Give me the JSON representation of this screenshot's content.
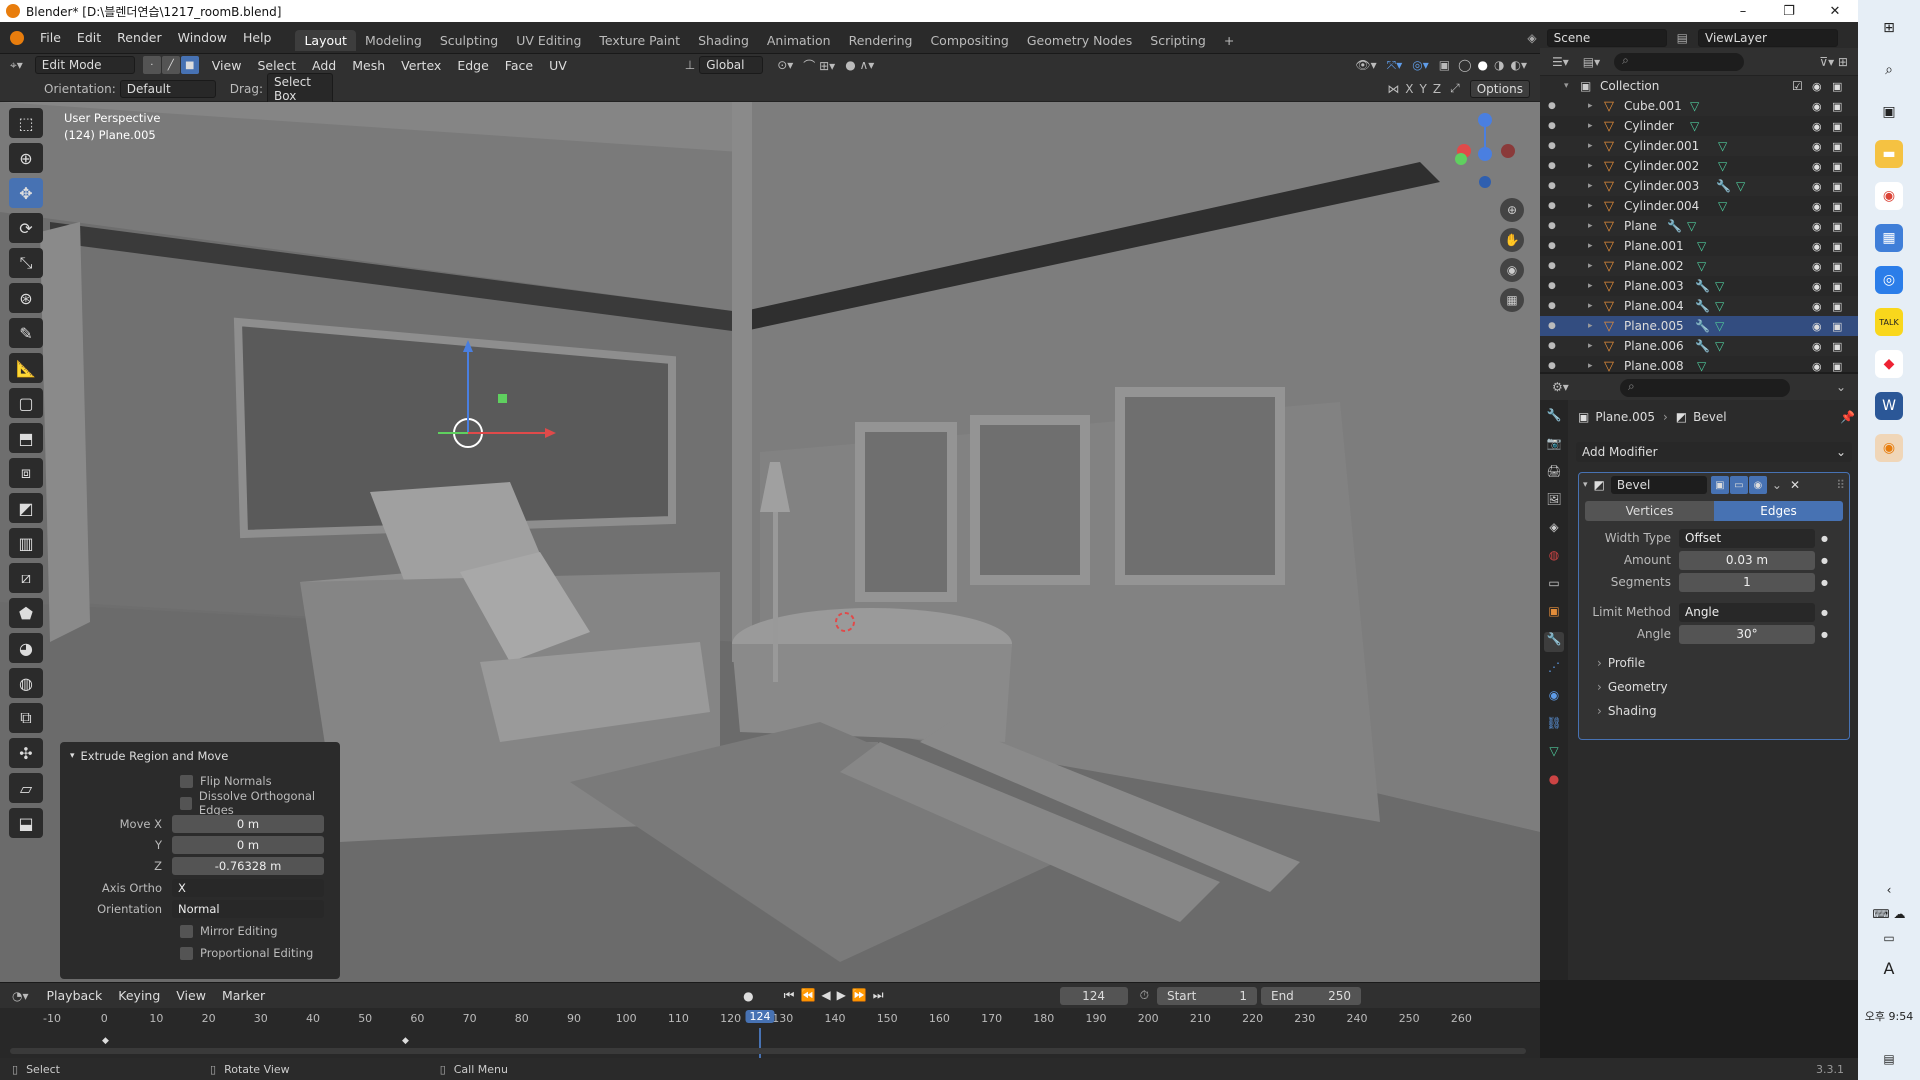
{
  "window": {
    "title": "Blender* [D:\\블렌더연습\\1217_roomB.blend]",
    "min": "–",
    "max": "❐",
    "close": "✕"
  },
  "topmenu": [
    "File",
    "Edit",
    "Render",
    "Window",
    "Help"
  ],
  "workspaces": [
    "Layout",
    "Modeling",
    "Sculpting",
    "UV Editing",
    "Texture Paint",
    "Shading",
    "Animation",
    "Rendering",
    "Compositing",
    "Geometry Nodes",
    "Scripting",
    "+"
  ],
  "scene": "Scene",
  "view_layer": "ViewLayer",
  "viewport_header": {
    "mode": "Edit Mode",
    "menus": [
      "View",
      "Select",
      "Add",
      "Mesh",
      "Vertex",
      "Edge",
      "Face",
      "UV"
    ],
    "transform": "Global"
  },
  "tool_settings": {
    "orientation_label": "Orientation:",
    "orientation": "Default",
    "drag_label": "Drag:",
    "drag": "Select Box",
    "axes": [
      "X",
      "Y",
      "Z"
    ],
    "options": "Options"
  },
  "viewport": {
    "perspective": "User Perspective",
    "object": "(124) Plane.005"
  },
  "operator_panel": {
    "title": "Extrude Region and Move",
    "flip_normals": "Flip Normals",
    "dissolve": "Dissolve Orthogonal Edges",
    "move_x_label": "Move X",
    "move_x": "0 m",
    "y_label": "Y",
    "y": "0 m",
    "z_label": "Z",
    "z": "-0.76328 m",
    "axis_ortho_label": "Axis Ortho",
    "axis_ortho": "X",
    "orientation_label": "Orientation",
    "orientation": "Normal",
    "mirror": "Mirror Editing",
    "proportional": "Proportional Editing"
  },
  "outliner": {
    "collection": "Collection",
    "items": [
      {
        "name": "Cube.001",
        "mod": false
      },
      {
        "name": "Cylinder",
        "mod": false
      },
      {
        "name": "Cylinder.001",
        "mod": false
      },
      {
        "name": "Cylinder.002",
        "mod": false
      },
      {
        "name": "Cylinder.003",
        "mod": true
      },
      {
        "name": "Cylinder.004",
        "mod": false
      },
      {
        "name": "Plane",
        "mod": true
      },
      {
        "name": "Plane.001",
        "mod": false
      },
      {
        "name": "Plane.002",
        "mod": false
      },
      {
        "name": "Plane.003",
        "mod": true
      },
      {
        "name": "Plane.004",
        "mod": true
      },
      {
        "name": "Plane.005",
        "mod": true,
        "selected": true
      },
      {
        "name": "Plane.006",
        "mod": true
      },
      {
        "name": "Plane.008",
        "mod": false
      }
    ]
  },
  "properties": {
    "breadcrumb_obj": "Plane.005",
    "breadcrumb_mod": "Bevel",
    "add_modifier": "Add Modifier",
    "modifier_name": "Bevel",
    "tab_vertices": "Vertices",
    "tab_edges": "Edges",
    "width_type_label": "Width Type",
    "width_type": "Offset",
    "amount_label": "Amount",
    "amount": "0.03 m",
    "segments_label": "Segments",
    "segments": "1",
    "limit_label": "Limit Method",
    "limit": "Angle",
    "angle_label": "Angle",
    "angle": "30°",
    "profile": "Profile",
    "geometry": "Geometry",
    "shading": "Shading"
  },
  "timeline": {
    "menus": [
      "Playback",
      "Keying",
      "View",
      "Marker"
    ],
    "current": "124",
    "start_label": "Start",
    "start": "1",
    "end_label": "End",
    "end": "250",
    "ticks": [
      "-10",
      "0",
      "10",
      "20",
      "30",
      "40",
      "50",
      "60",
      "70",
      "80",
      "90",
      "100",
      "110",
      "120",
      "130",
      "140",
      "150",
      "160",
      "170",
      "180",
      "190",
      "200",
      "210",
      "220",
      "230",
      "240",
      "250",
      "260"
    ]
  },
  "statusbar": {
    "select": "Select",
    "rotate": "Rotate View",
    "call_menu": "Call Menu",
    "version": "3.3.1"
  },
  "taskbar": {
    "time": "오후 9:54",
    "ime": "A"
  }
}
